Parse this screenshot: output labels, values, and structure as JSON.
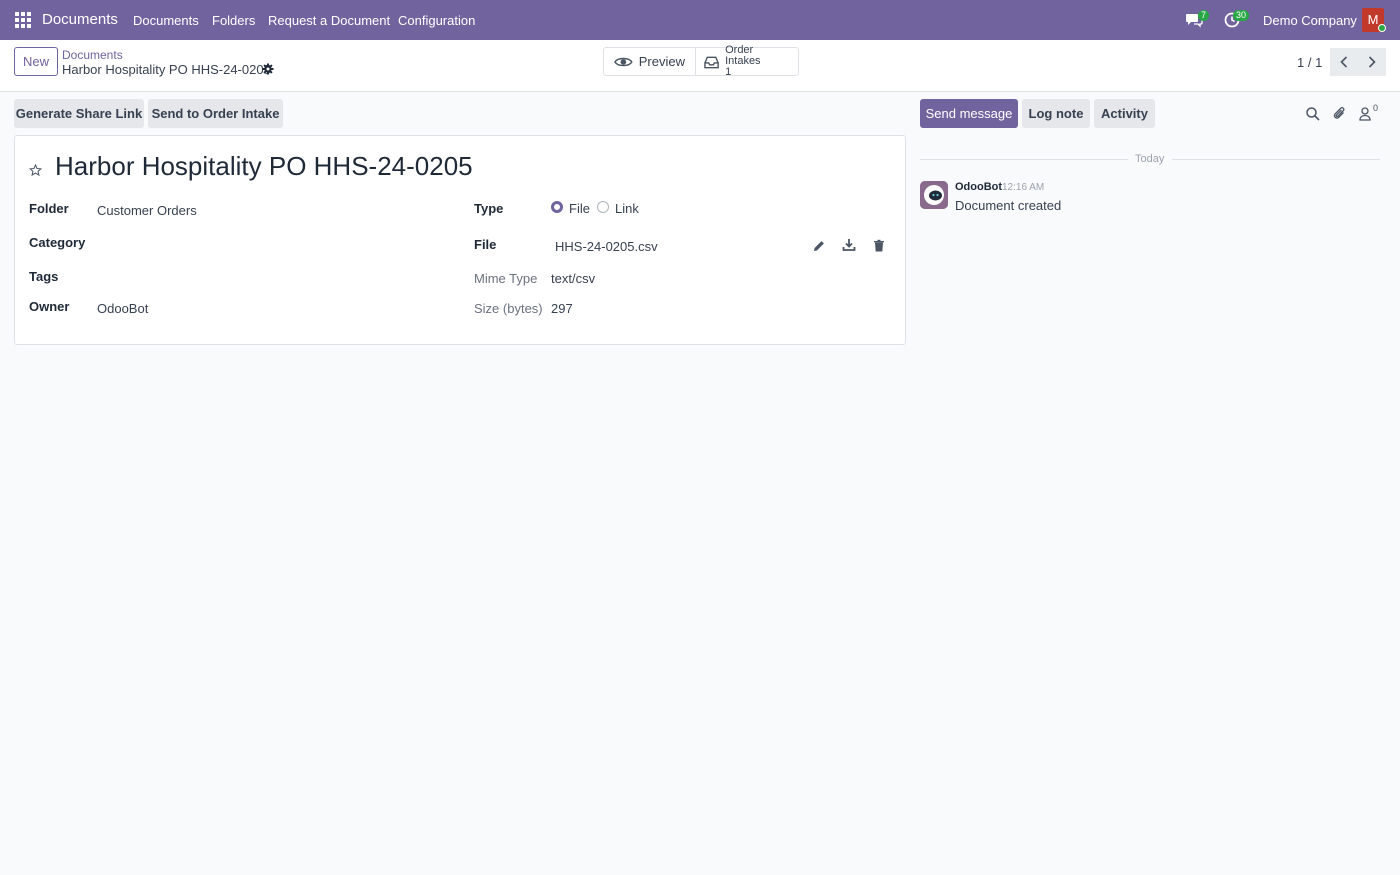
{
  "navbar": {
    "brand": "Documents",
    "menu": [
      "Documents",
      "Folders",
      "Request a Document",
      "Configuration"
    ],
    "messages_badge": "7",
    "activities_badge": "30",
    "company": "Demo Company",
    "user_initial": "M"
  },
  "control_panel": {
    "new_label": "New",
    "breadcrumb_parent": "Documents",
    "breadcrumb_current": "Harbor Hospitality PO HHS-24-0205",
    "preview_label": "Preview",
    "order_intakes_label": "Order Intakes",
    "order_intakes_count": "1",
    "pager": "1 / 1"
  },
  "actions": {
    "generate_share_link": "Generate Share Link",
    "send_to_order_intake": "Send to Order Intake"
  },
  "chatter_actions": {
    "send_message": "Send message",
    "log_note": "Log note",
    "activity": "Activity",
    "followers_count": "0"
  },
  "form": {
    "title": "Harbor Hospitality PO HHS-24-0205",
    "folder_label": "Folder",
    "folder_value": "Customer Orders",
    "category_label": "Category",
    "tags_label": "Tags",
    "owner_label": "Owner",
    "owner_value": "OdooBot",
    "type_label": "Type",
    "type_options": [
      "File",
      "Link"
    ],
    "type_selected": "File",
    "file_label": "File",
    "file_value": "HHS-24-0205.csv",
    "mime_label": "Mime Type",
    "mime_value": "text/csv",
    "size_label": "Size (bytes)",
    "size_value": "297"
  },
  "chatter": {
    "separator": "Today",
    "messages": [
      {
        "author": "OdooBot",
        "time": "12:16 AM",
        "body": "Document created"
      }
    ]
  },
  "colors": {
    "brand": "#71639e",
    "badge": "#28a745",
    "avatar": "#c0392b"
  }
}
